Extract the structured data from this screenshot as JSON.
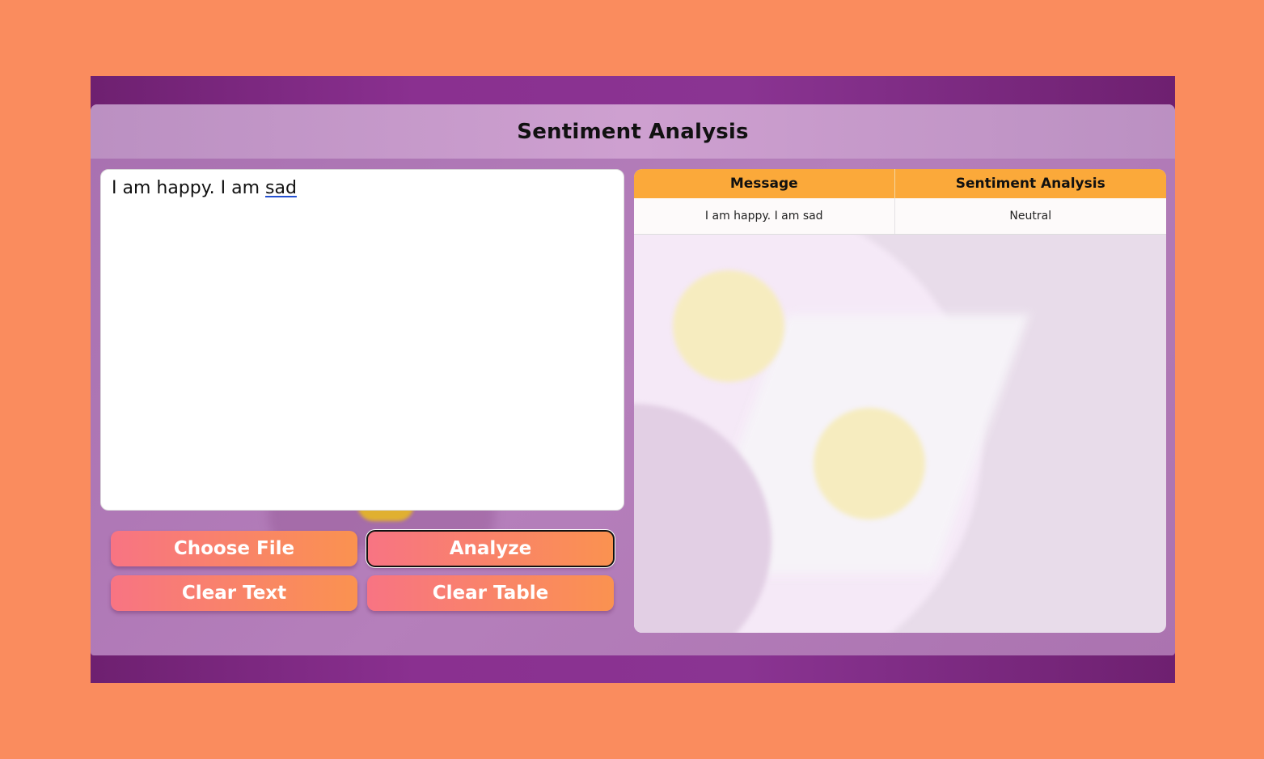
{
  "app": {
    "title": "Sentiment Analysis"
  },
  "editor": {
    "text_before": "I am happy. I am ",
    "text_flagged": "sad"
  },
  "buttons": {
    "choose_file": "Choose File",
    "analyze": "Analyze",
    "clear_text": "Clear Text",
    "clear_table": "Clear Table"
  },
  "table": {
    "headers": [
      "Message",
      "Sentiment Analysis"
    ],
    "rows": [
      {
        "message": "I am happy. I am sad",
        "sentiment": "Neutral"
      }
    ]
  },
  "colors": {
    "page_background": "#fa8c5e",
    "frame_purple": "#8a3090",
    "table_header": "#fba93a",
    "button_gradient_start": "#f87483",
    "button_gradient_end": "#fa9250"
  }
}
